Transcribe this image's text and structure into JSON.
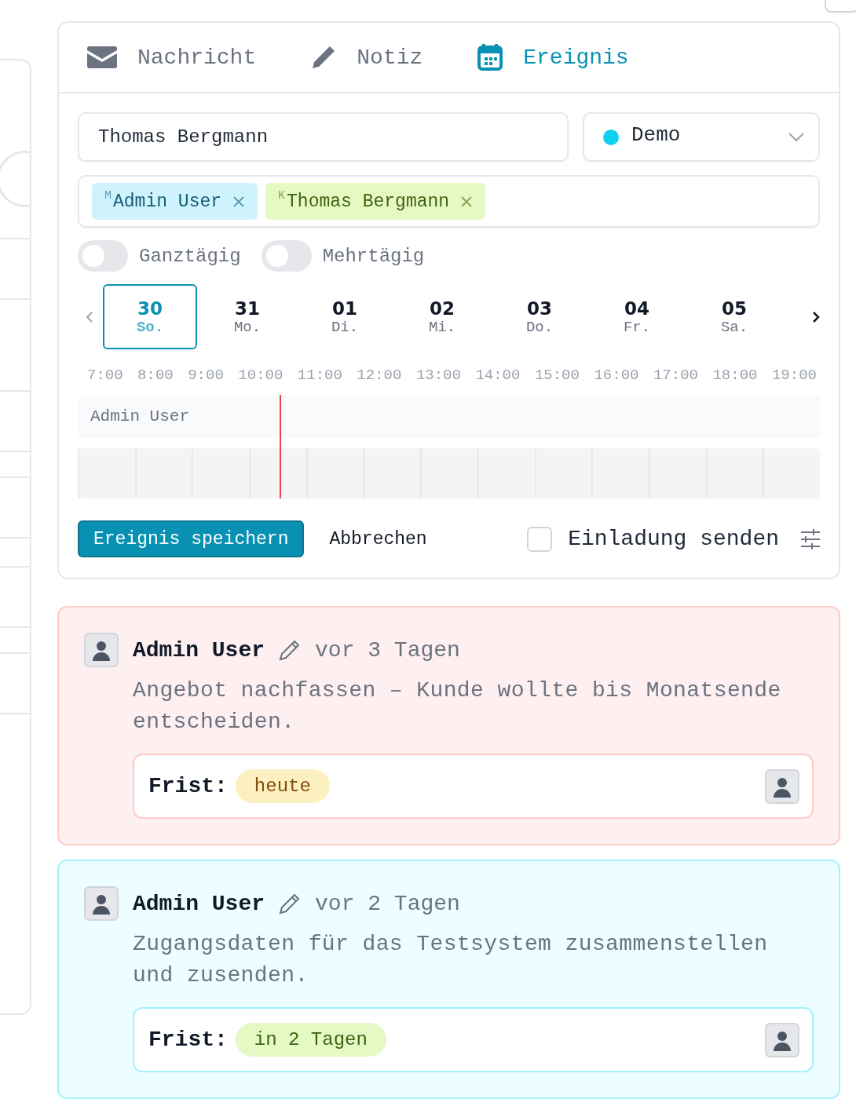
{
  "tabs": [
    {
      "label": "Nachricht",
      "kind": "mail",
      "selected": false
    },
    {
      "label": "Notiz",
      "kind": "pencil",
      "selected": false
    },
    {
      "label": "Ereignis",
      "kind": "calendar",
      "selected": true
    }
  ],
  "title_field": {
    "value": "Thomas Bergmann"
  },
  "calendar_select": {
    "value": "Demo",
    "color": "#0fd0ef"
  },
  "participants": [
    {
      "prefix": "M",
      "name": "Admin User",
      "kind": "member"
    },
    {
      "prefix": "K",
      "name": "Thomas Bergmann",
      "kind": "contact"
    }
  ],
  "toggles": [
    {
      "label": "Ganztägig",
      "on": false
    },
    {
      "label": "Mehrtägig",
      "on": false
    }
  ],
  "days": [
    {
      "number": "30",
      "weekday": "So.",
      "selected": true
    },
    {
      "number": "31",
      "weekday": "Mo.",
      "selected": false
    },
    {
      "number": "01",
      "weekday": "Di.",
      "selected": false
    },
    {
      "number": "02",
      "weekday": "Mi.",
      "selected": false
    },
    {
      "number": "03",
      "weekday": "Do.",
      "selected": false
    },
    {
      "number": "04",
      "weekday": "Fr.",
      "selected": false
    },
    {
      "number": "05",
      "weekday": "Sa.",
      "selected": false
    }
  ],
  "hours": [
    "7:00",
    "8:00",
    "9:00",
    "10:00",
    "11:00",
    "12:00",
    "13:00",
    "14:00",
    "15:00",
    "16:00",
    "17:00",
    "18:00",
    "19:00"
  ],
  "timeline": {
    "row_label": "Admin User",
    "now_marker": {
      "level": 0.272
    }
  },
  "save_button": "Ereignis speichern",
  "cancel_button": "Abbrechen",
  "invite": {
    "label": "Einladung senden",
    "checked": false
  },
  "notes": [
    {
      "kind": "overdue",
      "author": "Admin User",
      "time": "vor 3 Tagen",
      "text": "Angebot nachfassen – Kunde wollte bis Monatsende entscheiden.",
      "deadline_label": "Frist:",
      "deadline": {
        "text": "heute",
        "kind": "today"
      }
    },
    {
      "kind": "upcoming",
      "author": "Admin User",
      "time": "vor 2 Tagen",
      "text": "Zugangsdaten für das Testsystem zusammenstellen und zusenden.",
      "deadline_label": "Frist:",
      "deadline": {
        "text": "in 2 Tagen",
        "kind": "soon"
      }
    }
  ]
}
